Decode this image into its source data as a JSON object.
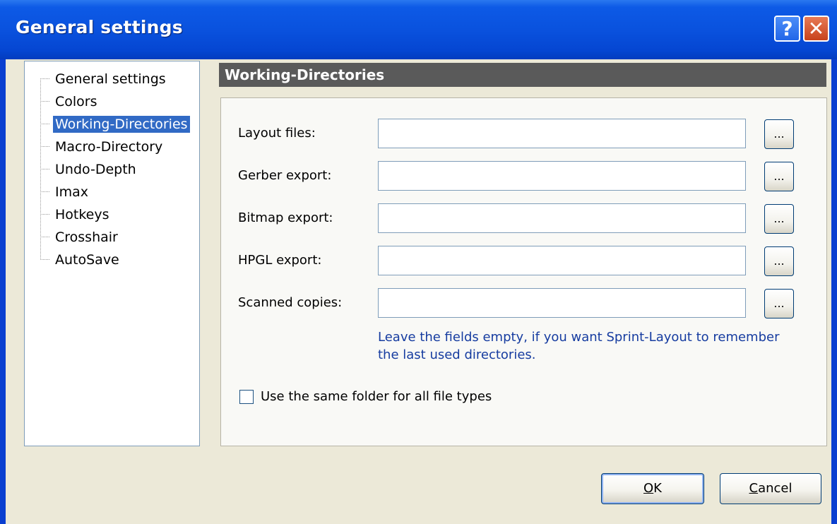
{
  "window": {
    "title": "General settings",
    "help_glyph": "?",
    "close_glyph": "✕"
  },
  "tree": {
    "items": [
      {
        "label": "General settings",
        "selected": false
      },
      {
        "label": "Colors",
        "selected": false
      },
      {
        "label": "Working-Directories",
        "selected": true
      },
      {
        "label": "Macro-Directory",
        "selected": false
      },
      {
        "label": "Undo-Depth",
        "selected": false
      },
      {
        "label": "Imax",
        "selected": false
      },
      {
        "label": "Hotkeys",
        "selected": false
      },
      {
        "label": "Crosshair",
        "selected": false
      },
      {
        "label": "AutoSave",
        "selected": false
      }
    ]
  },
  "section": {
    "title": "Working-Directories"
  },
  "directories": [
    {
      "label": "Layout files:",
      "value": "",
      "browse_label": "..."
    },
    {
      "label": "Gerber export:",
      "value": "",
      "browse_label": "..."
    },
    {
      "label": "Bitmap export:",
      "value": "",
      "browse_label": "..."
    },
    {
      "label": "HPGL export:",
      "value": "",
      "browse_label": "..."
    },
    {
      "label": "Scanned copies:",
      "value": "",
      "browse_label": "..."
    }
  ],
  "hint": {
    "line1": "Leave the fields empty, if you want Sprint-Layout to remember",
    "line2": "the last used directories."
  },
  "same_folder": {
    "label": "Use the same folder for all file types",
    "checked": false
  },
  "buttons": {
    "ok_mnemonic": "O",
    "ok_rest": "K",
    "cancel_mnemonic": "C",
    "cancel_rest": "ancel"
  },
  "colors": {
    "titlebar": "#0a52de",
    "selection": "#316ac5",
    "section_header": "#5a5a5a",
    "hint_text": "#163ca0",
    "dialog_bg": "#ece9d8"
  }
}
